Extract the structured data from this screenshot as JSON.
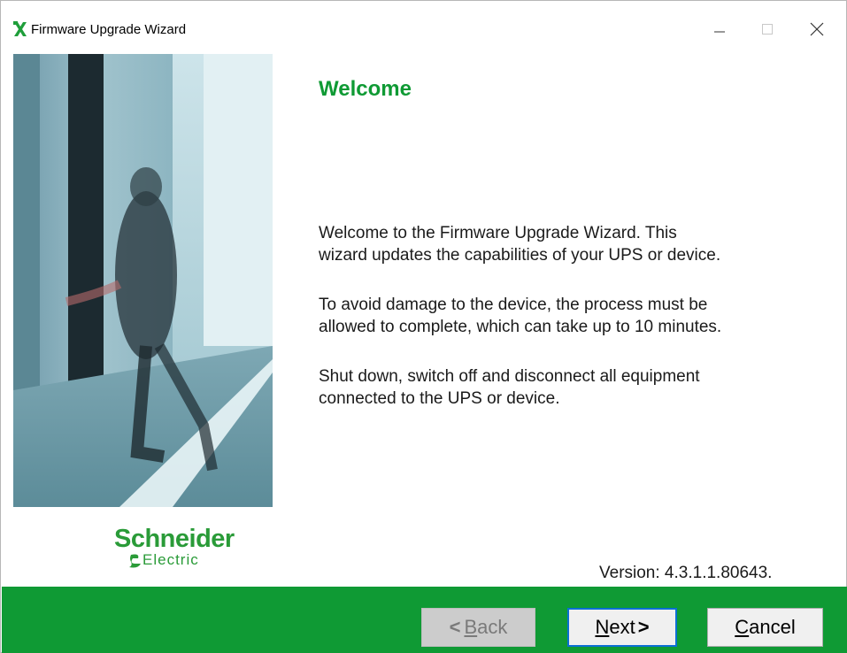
{
  "window": {
    "title": "Firmware Upgrade Wizard",
    "controls": [
      "minimize-icon",
      "maximize-icon",
      "close-icon"
    ]
  },
  "brand": {
    "logo_line1": "Schneider",
    "logo_line2": "Electric",
    "accent_color": "#0f9a34"
  },
  "content": {
    "heading": "Welcome",
    "paragraph1_line1": "Welcome to the Firmware Upgrade Wizard. This",
    "paragraph1_line2": "wizard updates the capabilities of your UPS or device.",
    "paragraph2_line1": "To avoid damage to the device, the process must be",
    "paragraph2_line2": "allowed to complete, which can take up to 10 minutes.",
    "paragraph3_line1": "Shut down, switch off and disconnect all equipment",
    "paragraph3_line2": "connected to the UPS or device.",
    "version": "Version:  4.3.1.1.80643."
  },
  "buttons": {
    "back_first": "B",
    "back_rest": "ack",
    "back_arrow": "<",
    "next_first": "N",
    "next_rest": "ext",
    "next_arrow": ">",
    "cancel_first": "C",
    "cancel_rest": "ancel"
  }
}
